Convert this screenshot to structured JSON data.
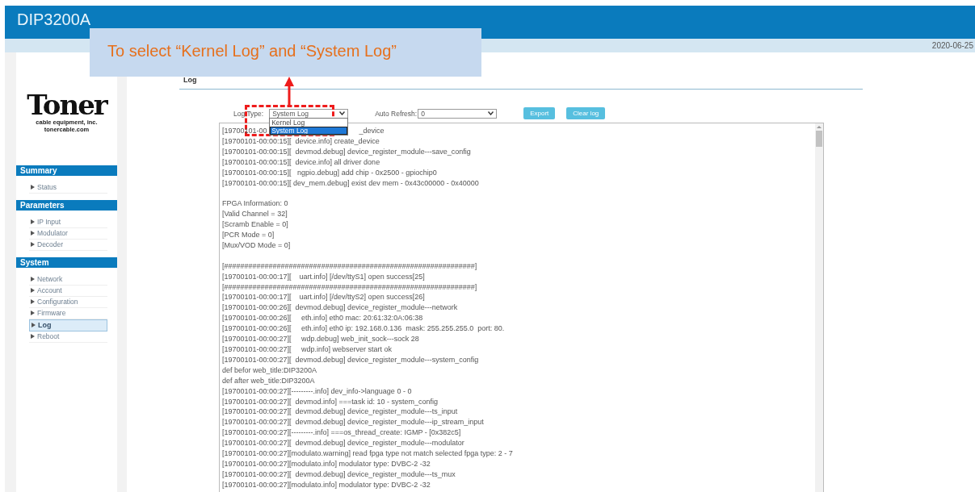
{
  "header": {
    "title": "DIP3200A",
    "date": "2020-06-25"
  },
  "annotation": {
    "text": "To select “Kernel Log” and “System Log”"
  },
  "sidebar": {
    "logo": {
      "word": "Toner",
      "tagline": "cable equipment, inc.",
      "url": "tonercable.com"
    },
    "sections": [
      {
        "title": "Summary",
        "items": [
          {
            "label": "Status",
            "selected": false
          }
        ]
      },
      {
        "title": "Parameters",
        "items": [
          {
            "label": "IP Input",
            "selected": false
          },
          {
            "label": "Modulator",
            "selected": false
          },
          {
            "label": "Decoder",
            "selected": false
          }
        ]
      },
      {
        "title": "System",
        "items": [
          {
            "label": "Network",
            "selected": false
          },
          {
            "label": "Account",
            "selected": false
          },
          {
            "label": "Configuration",
            "selected": false
          },
          {
            "label": "Firmware",
            "selected": false
          },
          {
            "label": "Log",
            "selected": true
          },
          {
            "label": "Reboot",
            "selected": false
          }
        ]
      }
    ]
  },
  "page": {
    "title": "Log"
  },
  "controls": {
    "log_type": {
      "label": "Log Type:",
      "value": "System Log",
      "options": [
        {
          "label": "Kernel Log",
          "selected": false
        },
        {
          "label": "System Log",
          "selected": true
        }
      ]
    },
    "auto_refresh": {
      "label": "Auto Refresh:",
      "value": "0"
    },
    "buttons": [
      "Export",
      "Clear log"
    ]
  },
  "log": {
    "covered_line": {
      "before": "[19700101-00",
      "after": "_device"
    },
    "blocks": [
      [
        "[19700101-00:00:15][  device.info] create_device",
        "[19700101-00:00:15][  devmod.debug] device_register_module---save_config",
        "[19700101-00:00:15][  device.info] all driver done",
        "[19700101-00:00:15][   ngpio.debug] add chip - 0x2500 - gpiochip0",
        "[19700101-00:00:15][ dev_mem.debug] exist dev mem - 0x43c00000 - 0x40000"
      ],
      [
        "FPGA Information: 0",
        "[Valid Channel = 32]",
        "[Scramb Enable = 0]",
        "[PCR Mode = 0]",
        "[Mux/VOD Mode = 0]"
      ],
      [
        "[##############################################################]",
        "[19700101-00:00:17][    uart.info] [/dev/ttyS1] open success[25]",
        "[##############################################################]",
        "[19700101-00:00:17][    uart.info] [/dev/ttyS2] open success[26]",
        "[19700101-00:00:26][  devmod.debug] device_register_module---network",
        "[19700101-00:00:26][     eth.info] eth0 mac: 20:61:32:0A:06:38",
        "[19700101-00:00:26][     eth.info] eth0 ip: 192.168.0.136  mask: 255.255.255.0  port: 80.",
        "[19700101-00:00:27][     wdp.debug] web_init_sock---sock 28",
        "[19700101-00:00:27][     wdp.info] webserver start ok",
        "[19700101-00:00:27][  devmod.debug] device_register_module---system_config",
        "def befor web_title:DIP3200A",
        "def after web_title:DIP3200A",
        "[19700101-00:00:27][---------.info] dev_info->language 0 - 0",
        "[19700101-00:00:27][  devmod.info] ===task id: 10 - system_config",
        "[19700101-00:00:27][  devmod.debug] device_register_module---ts_input",
        "[19700101-00:00:27][  devmod.debug] device_register_module---ip_stream_input",
        "[19700101-00:00:27][---------.info] ===os_thread_create: IGMP - [0x382c5]",
        "[19700101-00:00:27][  devmod.debug] device_register_module---modulator",
        "[19700101-00:00:27][modulato.warning] read fpga type not match selected fpga type: 2 - 7",
        "[19700101-00:00:27][modulato.info] modulator type: DVBC-2 -32",
        "[19700101-00:00:27][  devmod.debug] device_register_module---ts_mux",
        "[19700101-00:00:27][modulato.info] modulator type: DVBC-2 -32"
      ]
    ]
  }
}
